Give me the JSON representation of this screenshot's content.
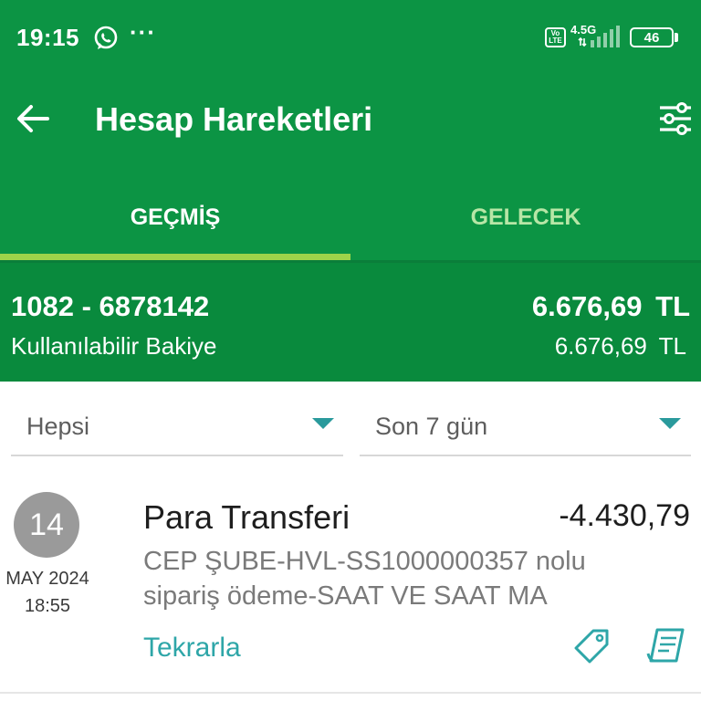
{
  "status_bar": {
    "time": "19:15",
    "dots": "···",
    "volte": "Vo LTE",
    "network": "4.5G",
    "battery": "46"
  },
  "app_bar": {
    "title": "Hesap Hareketleri"
  },
  "tabs": [
    {
      "label": "GEÇMİŞ",
      "active": true
    },
    {
      "label": "GELECEK",
      "active": false
    }
  ],
  "account": {
    "number": "1082 - 6878142",
    "balance": "6.676,69 TL",
    "available_label": "Kullanılabilir Bakiye",
    "available_value": "6.676,69 TL"
  },
  "filters": {
    "type": "Hepsi",
    "period": "Son 7 gün"
  },
  "transactions": [
    {
      "day": "14",
      "month_year": "MAY 2024",
      "time": "18:55",
      "title": "Para Transferi",
      "amount": "-4.430,79",
      "description": "CEP ŞUBE-HVL-SS1000000357 nolu sipariş ödeme-SAAT VE SAAT MA",
      "action": "Tekrarla"
    }
  ],
  "colors": {
    "primary": "#0c9444",
    "summary": "#098a3d",
    "indicator": "#9ed34a",
    "link": "#2ea6a8"
  }
}
